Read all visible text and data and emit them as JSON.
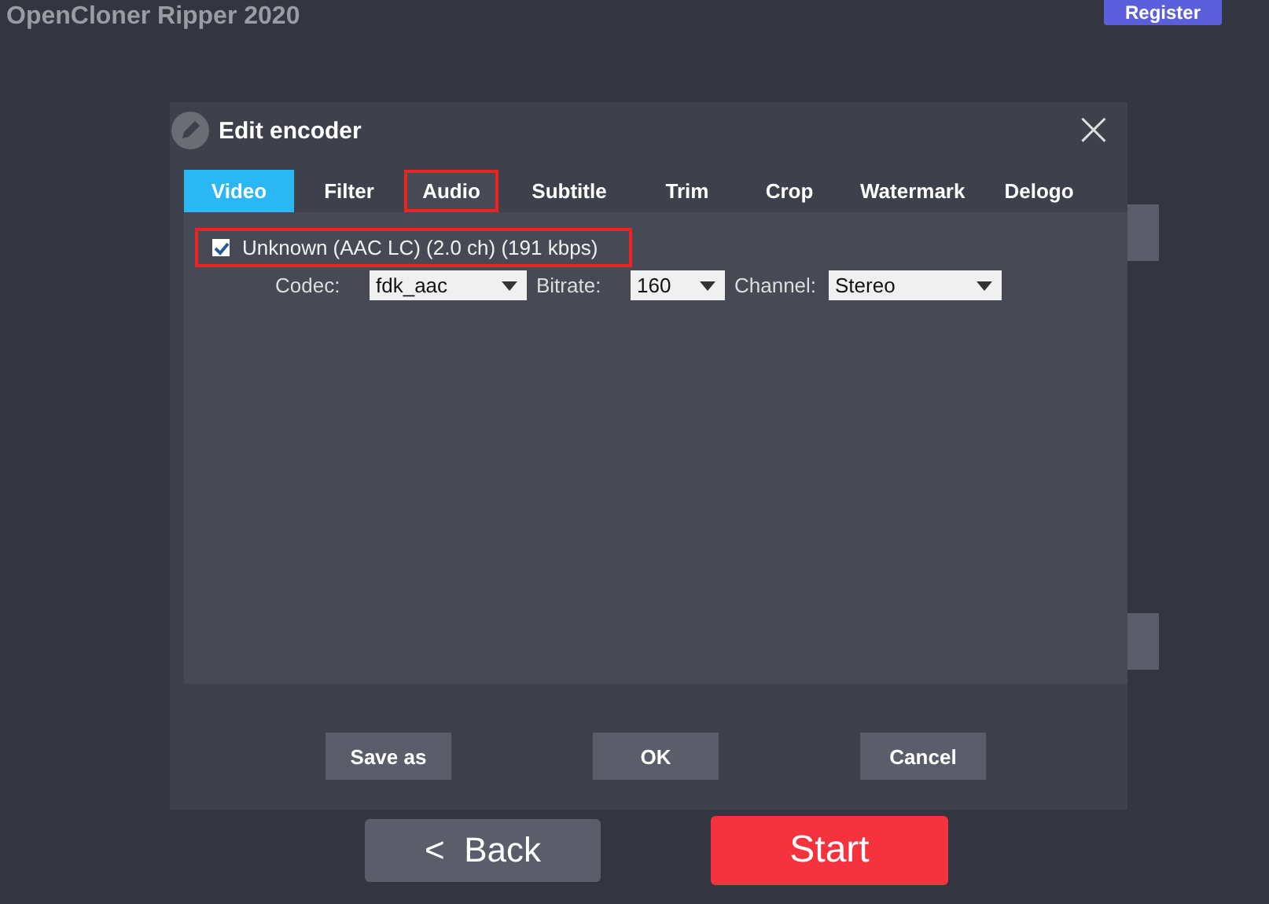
{
  "app": {
    "title": "OpenCloner Ripper 2020",
    "register_button": "Register"
  },
  "dialog": {
    "title": "Edit encoder",
    "close": "×",
    "tabs": [
      {
        "label": "Video",
        "selected": true,
        "highlighted": false
      },
      {
        "label": "Filter",
        "selected": false,
        "highlighted": false
      },
      {
        "label": "Audio",
        "selected": false,
        "highlighted": true
      },
      {
        "label": "Subtitle",
        "selected": false,
        "highlighted": false
      },
      {
        "label": "Trim",
        "selected": false,
        "highlighted": false
      },
      {
        "label": "Crop",
        "selected": false,
        "highlighted": false
      },
      {
        "label": "Watermark",
        "selected": false,
        "highlighted": false
      },
      {
        "label": "Delogo",
        "selected": false,
        "highlighted": false
      }
    ],
    "track": {
      "label": "Unknown (AAC LC) (2.0 ch) (191 kbps)",
      "checked": true,
      "highlighted": true
    },
    "settings": [
      {
        "label": "Codec:",
        "value": "fdk_aac"
      },
      {
        "label": "Bitrate:",
        "value": "160"
      },
      {
        "label": "Channel:",
        "value": "Stereo"
      }
    ],
    "buttons": [
      "Save as",
      "OK",
      "Cancel"
    ]
  },
  "nav": {
    "back": "<  Back",
    "start": "Start"
  }
}
